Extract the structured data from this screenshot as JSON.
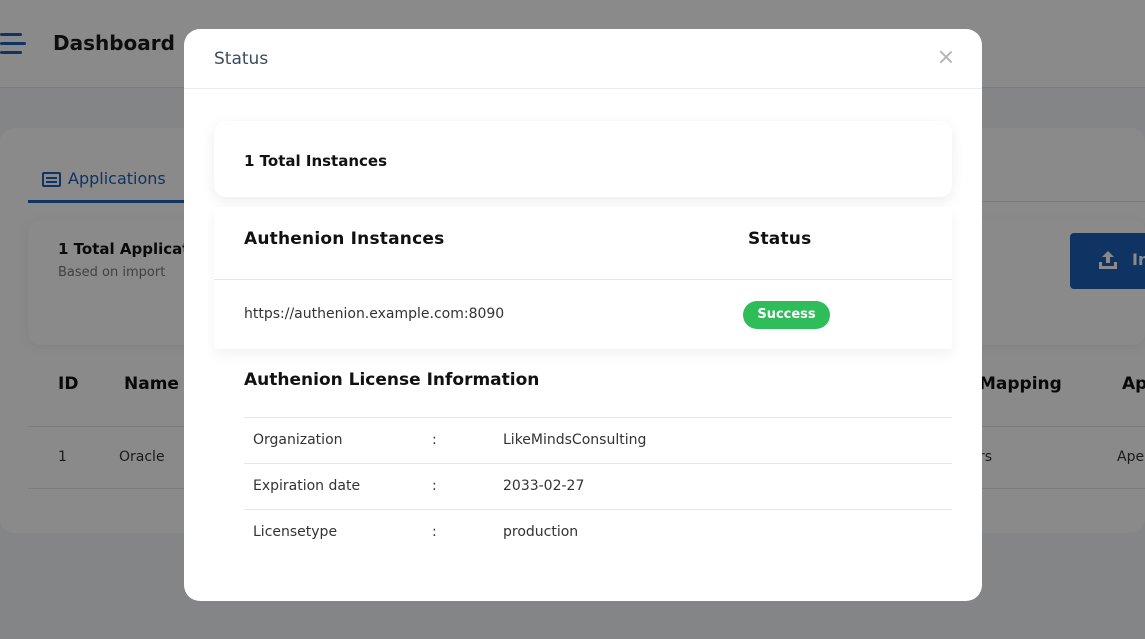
{
  "background": {
    "header_title": "Dashboard",
    "tab_applications": "Applications",
    "total_applications": "1 Total Applicati",
    "based_on": "Based on import",
    "import_button": "In",
    "table_headers": [
      "ID",
      "Name",
      "Mapping",
      "Ap"
    ],
    "table_row": {
      "id": "1",
      "name": "Oracle",
      "mapping": "rs",
      "app": "Ape"
    }
  },
  "modal": {
    "title": "Status",
    "total_instances": "1 Total Instances",
    "instances_header": "Authenion Instances",
    "status_header": "Status",
    "instances": [
      {
        "url": "https://authenion.example.com:8090",
        "status": "Success"
      }
    ],
    "license_title": "Authenion License Information",
    "license": [
      {
        "key": "Organization",
        "sep": ":",
        "value": "LikeMindsConsulting"
      },
      {
        "key": "Expiration date",
        "sep": ":",
        "value": "2033-02-27"
      },
      {
        "key": "Licensetype",
        "sep": ":",
        "value": "production"
      }
    ]
  },
  "colors": {
    "primary": "#1d5fb8",
    "success": "#2ebd59",
    "overlay": "#000000"
  }
}
